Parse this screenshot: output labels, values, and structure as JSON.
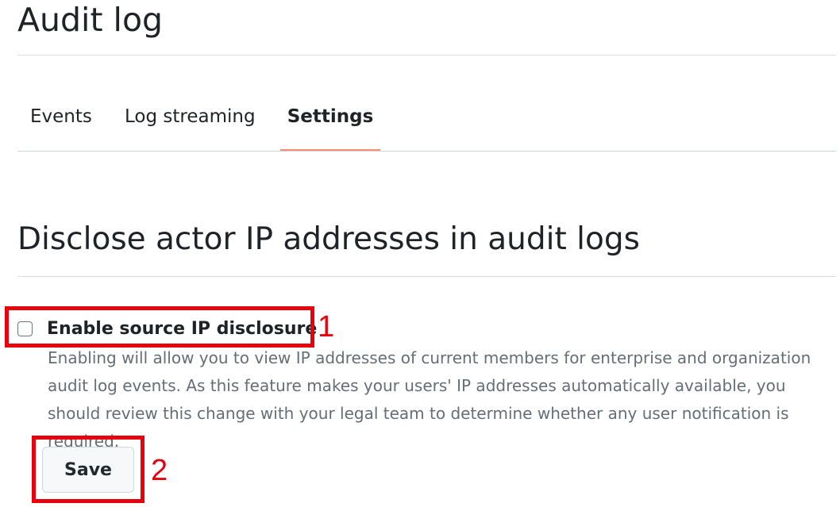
{
  "page": {
    "title": "Audit log"
  },
  "tabs": [
    {
      "label": "Events",
      "selected": false
    },
    {
      "label": "Log streaming",
      "selected": false
    },
    {
      "label": "Settings",
      "selected": true
    }
  ],
  "section": {
    "title": "Disclose actor IP addresses in audit logs",
    "checkbox": {
      "label": "Enable source IP disclosure",
      "checked": false
    },
    "help_text": "Enabling will allow you to view IP addresses of current members for enterprise and organization audit log events. As this feature makes your users' IP addresses automatically available, you should review this change with your legal team to determine whether any user notification is required.",
    "save_label": "Save"
  },
  "annotations": [
    {
      "label": "1",
      "target": "enable-source-ip-checkbox",
      "color": "#e8000d"
    },
    {
      "label": "2",
      "target": "save-button",
      "color": "#e8000d"
    }
  ],
  "colors": {
    "selected_tab_underline": "#fd8c73",
    "annotation_red": "#e8000d",
    "muted_text": "#656d76"
  }
}
